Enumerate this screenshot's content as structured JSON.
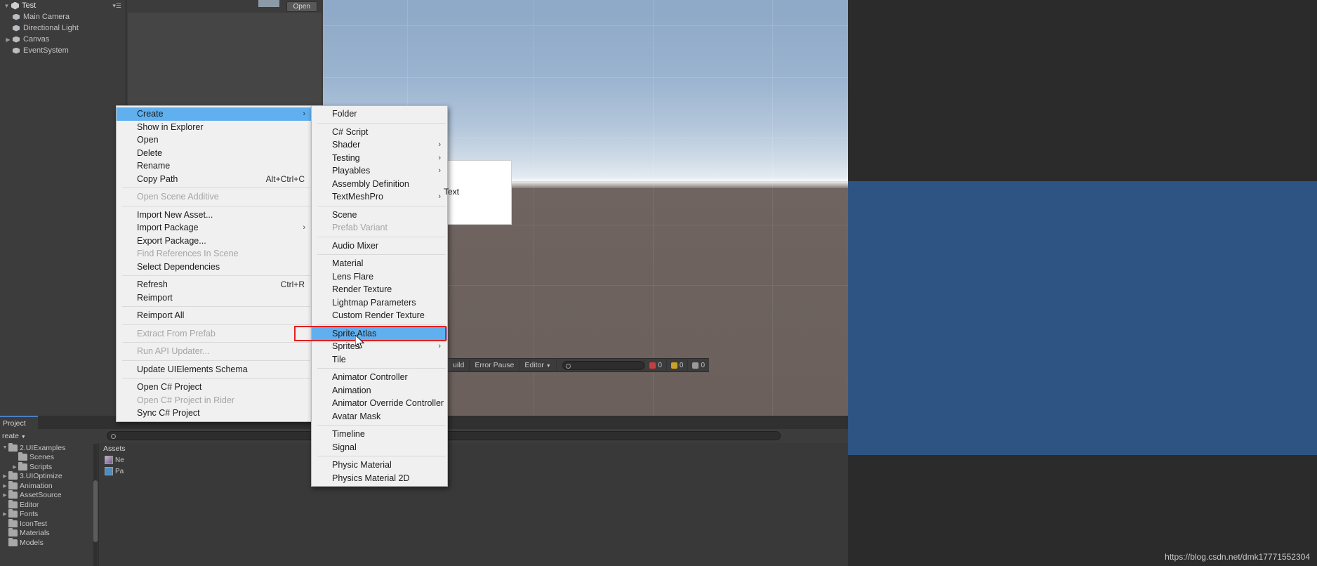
{
  "app": "Unity Editor",
  "hierarchy": {
    "scene_name": "Test",
    "menu_icon": "hamburger-icon",
    "items": [
      {
        "label": "Main Camera",
        "expandable": false
      },
      {
        "label": "Directional Light",
        "expandable": false
      },
      {
        "label": "Canvas",
        "expandable": true
      },
      {
        "label": "EventSystem",
        "expandable": false
      }
    ]
  },
  "inspector": {
    "open_label": "Open"
  },
  "scene": {
    "ui_text_label": "Text"
  },
  "context_menu": {
    "items": [
      {
        "label": "Create",
        "selected": true,
        "submenu": true,
        "shortcut": ""
      },
      {
        "label": "Show in Explorer"
      },
      {
        "label": "Open"
      },
      {
        "label": "Delete"
      },
      {
        "label": "Rename"
      },
      {
        "label": "Copy Path",
        "shortcut": "Alt+Ctrl+C"
      },
      {
        "separator": true
      },
      {
        "label": "Open Scene Additive",
        "disabled": true
      },
      {
        "separator": true
      },
      {
        "label": "Import New Asset..."
      },
      {
        "label": "Import Package",
        "submenu": true
      },
      {
        "label": "Export Package..."
      },
      {
        "label": "Find References In Scene",
        "disabled": true
      },
      {
        "label": "Select Dependencies"
      },
      {
        "separator": true
      },
      {
        "label": "Refresh",
        "shortcut": "Ctrl+R"
      },
      {
        "label": "Reimport"
      },
      {
        "separator": true
      },
      {
        "label": "Reimport All"
      },
      {
        "separator": true
      },
      {
        "label": "Extract From Prefab",
        "disabled": true
      },
      {
        "separator": true
      },
      {
        "label": "Run API Updater...",
        "disabled": true
      },
      {
        "separator": true
      },
      {
        "label": "Update UIElements Schema"
      },
      {
        "separator": true
      },
      {
        "label": "Open C# Project"
      },
      {
        "label": "Open C# Project in Rider",
        "disabled": true
      },
      {
        "label": "Sync C# Project"
      }
    ]
  },
  "create_submenu": {
    "items": [
      {
        "label": "Folder"
      },
      {
        "separator": true
      },
      {
        "label": "C# Script"
      },
      {
        "label": "Shader",
        "submenu": true
      },
      {
        "label": "Testing",
        "submenu": true
      },
      {
        "label": "Playables",
        "submenu": true
      },
      {
        "label": "Assembly Definition"
      },
      {
        "label": "TextMeshPro",
        "submenu": true
      },
      {
        "separator": true
      },
      {
        "label": "Scene"
      },
      {
        "label": "Prefab Variant",
        "disabled": true
      },
      {
        "separator": true
      },
      {
        "label": "Audio Mixer"
      },
      {
        "separator": true
      },
      {
        "label": "Material"
      },
      {
        "label": "Lens Flare"
      },
      {
        "label": "Render Texture"
      },
      {
        "label": "Lightmap Parameters"
      },
      {
        "label": "Custom Render Texture"
      },
      {
        "separator": true
      },
      {
        "label": "Sprite Atlas",
        "selected": true,
        "highlighted": true
      },
      {
        "label": "Sprites",
        "submenu": true
      },
      {
        "label": "Tile"
      },
      {
        "separator": true
      },
      {
        "label": "Animator Controller"
      },
      {
        "label": "Animation"
      },
      {
        "label": "Animator Override Controller"
      },
      {
        "label": "Avatar Mask"
      },
      {
        "separator": true
      },
      {
        "label": "Timeline"
      },
      {
        "label": "Signal"
      },
      {
        "separator": true
      },
      {
        "label": "Physic Material"
      },
      {
        "label": "Physics Material 2D"
      }
    ]
  },
  "console_toolbar": {
    "clear_label": "uild",
    "error_pause_label": "Error Pause",
    "editor_label": "Editor",
    "search_placeholder": "",
    "error_count": "0",
    "warning_count": "0",
    "info_count": "0"
  },
  "project": {
    "tab_label": "Project",
    "create_label": "reate",
    "search_placeholder": "",
    "assets_header": "Assets",
    "tree": [
      {
        "label": "2.UIExamples",
        "indent": 0,
        "expandable": true,
        "expanded": true
      },
      {
        "label": "Scenes",
        "indent": 1,
        "expandable": false
      },
      {
        "label": "Scripts",
        "indent": 1,
        "expandable": true
      },
      {
        "label": "3.UIOptimize",
        "indent": 0,
        "expandable": true
      },
      {
        "label": "Animation",
        "indent": 0,
        "expandable": true
      },
      {
        "label": "AssetSource",
        "indent": 0,
        "expandable": true
      },
      {
        "label": "Editor",
        "indent": 0,
        "expandable": false
      },
      {
        "label": "Fonts",
        "indent": 0,
        "expandable": true
      },
      {
        "label": "IconTest",
        "indent": 0,
        "expandable": false
      },
      {
        "label": "Materials",
        "indent": 0,
        "expandable": false
      },
      {
        "label": "Models",
        "indent": 0,
        "expandable": false
      }
    ],
    "assets": [
      {
        "label": "Ne",
        "icon": "image-asset-icon"
      },
      {
        "label": "Pa",
        "icon": "prefab-asset-icon"
      }
    ]
  },
  "watermark": "https://blog.csdn.net/dmk17771552304",
  "colors": {
    "menu_bg": "#f0f0f0",
    "menu_highlight": "#60b0f0",
    "annotation": "#e02020",
    "editor_bg": "#383838",
    "game_bg": "#2e5484"
  }
}
